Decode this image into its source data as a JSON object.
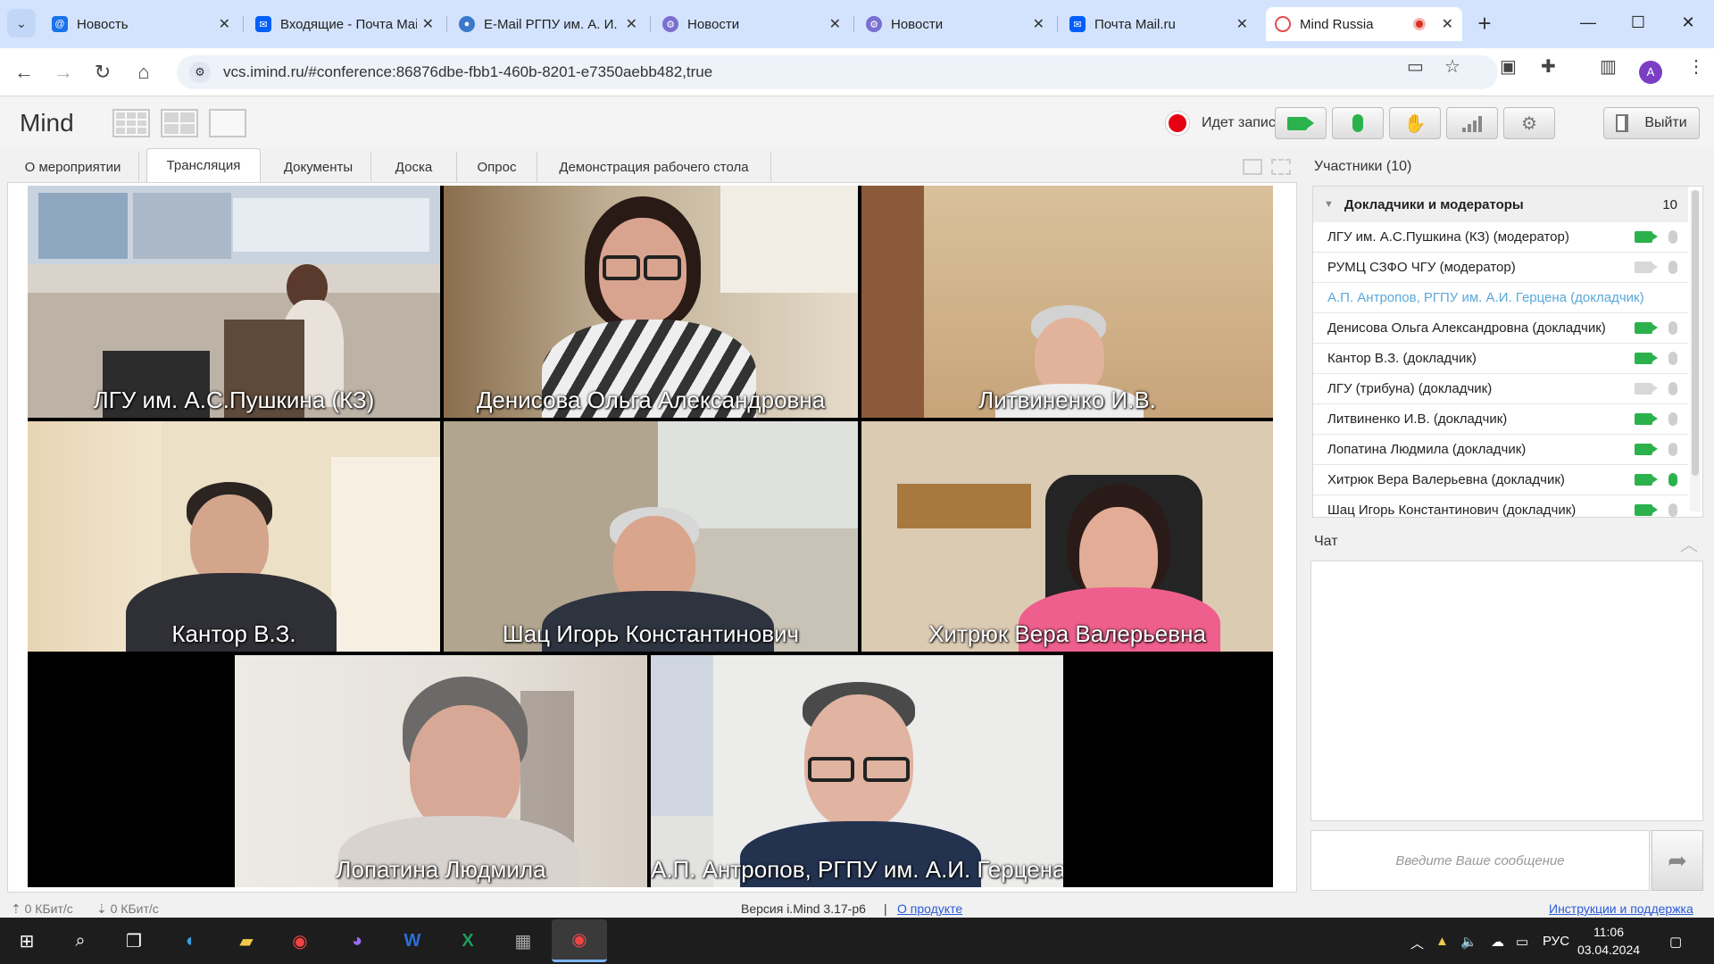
{
  "browser": {
    "tabs": [
      {
        "title": "Новость",
        "icon": "at-sign-icon",
        "color": "#1a73e8"
      },
      {
        "title": "Входящие - Почта Mail.ru",
        "icon": "mail-icon",
        "color": "#005ff9"
      },
      {
        "title": "E-Mail РГПУ им. А. И. Герцена",
        "icon": "globe-icon",
        "color": "#3b78c9"
      },
      {
        "title": "Новости",
        "icon": "gear-icon",
        "color": "#7a6fd1"
      },
      {
        "title": "Новости",
        "icon": "gear-icon",
        "color": "#7a6fd1"
      },
      {
        "title": "Почта Mail.ru",
        "icon": "mail-icon",
        "color": "#005ff9"
      },
      {
        "title": "Mind Russia",
        "icon": "mind-icon",
        "color": "#e34b4b",
        "active": true
      }
    ],
    "new_tab": "+",
    "url": "vcs.imind.ru/#conference:86876dbe-fbb1-460b-8201-e7350aebb482,true",
    "profile_initial": "A"
  },
  "app": {
    "logo": "Mind",
    "recording_label": "Идет запись",
    "exit_label": "Выйти",
    "tabs": [
      {
        "label": "О мероприятии"
      },
      {
        "label": "Трансляция",
        "active": true
      },
      {
        "label": "Документы"
      },
      {
        "label": "Доска"
      },
      {
        "label": "Опрос"
      },
      {
        "label": "Демонстрация рабочего стола"
      }
    ]
  },
  "videos": [
    {
      "name": "ЛГУ им. А.С.Пушкина (КЗ)"
    },
    {
      "name": "Денисова Ольга Александровна"
    },
    {
      "name": "Литвиненко И.В."
    },
    {
      "name": "Кантор В.З."
    },
    {
      "name": "Шац Игорь Константинович"
    },
    {
      "name": "Хитрюк Вера Валерьевна"
    },
    {
      "name": "Лопатина Людмила"
    },
    {
      "name": "А.П. Антропов, РГПУ им. А.И. Герцена"
    }
  ],
  "participants": {
    "title": "Участники (10)",
    "group": {
      "label": "Докладчики и модераторы",
      "count": "10"
    },
    "rows": [
      {
        "name": "ЛГУ им. А.С.Пушкина (КЗ) (модератор)",
        "cam": "on",
        "mic": "off"
      },
      {
        "name": "РУМЦ СЗФО ЧГУ (модератор)",
        "cam": "off",
        "mic": "off"
      },
      {
        "name": "А.П. Антропов, РГПУ им. А.И. Герцена (докладчик)",
        "cam": "none",
        "mic": "none",
        "listener": true
      },
      {
        "name": "Денисова Ольга Александровна (докладчик)",
        "cam": "on",
        "mic": "off"
      },
      {
        "name": "Кантор В.З. (докладчик)",
        "cam": "on",
        "mic": "off"
      },
      {
        "name": "ЛГУ (трибуна) (докладчик)",
        "cam": "off",
        "mic": "off"
      },
      {
        "name": "Литвиненко И.В. (докладчик)",
        "cam": "on",
        "mic": "off"
      },
      {
        "name": "Лопатина Людмила (докладчик)",
        "cam": "on",
        "mic": "off"
      },
      {
        "name": "Хитрюк Вера Валерьевна (докладчик)",
        "cam": "on",
        "mic": "on"
      },
      {
        "name": "Шац Игорь Константинович (докладчик)",
        "cam": "on",
        "mic": "off"
      }
    ]
  },
  "chat": {
    "title": "Чат",
    "placeholder": "Введите Ваше сообщение"
  },
  "status": {
    "upload": "0 КБит/с",
    "download": "0 КБит/с",
    "version": "Версия i.Mind 3.17-p6",
    "about_link": "О продукте",
    "help_link": "Инструкции и поддержка"
  },
  "taskbar": {
    "lang": "РУС",
    "time": "11:06",
    "date": "03.04.2024"
  }
}
